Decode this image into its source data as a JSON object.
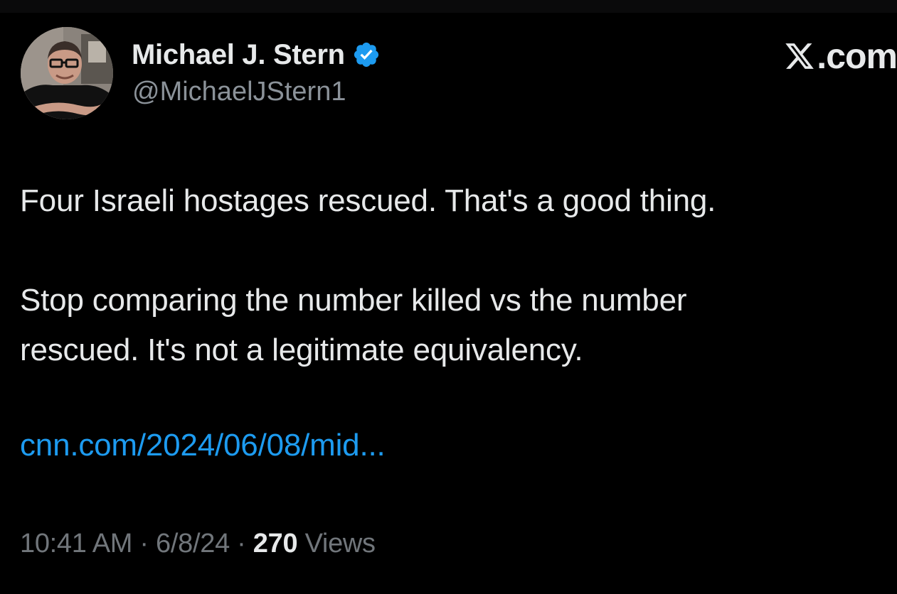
{
  "author": {
    "display_name": "Michael J. Stern",
    "handle": "@MichaelJStern1",
    "verified_icon": "verified-badge-icon",
    "verified_color": "#1d9bf0"
  },
  "brand": {
    "text": ".com",
    "icon": "x-logo-icon"
  },
  "tweet": {
    "paragraph_1": "Four Israeli hostages rescued.  That's a good thing.",
    "paragraph_2_line_1": "Stop comparing the number killed vs the number",
    "paragraph_2_line_2": "rescued.  It's not a legitimate equivalency.",
    "link_text": "cnn.com/2024/06/08/mid...",
    "link_color": "#1d9bf0"
  },
  "meta": {
    "time": "10:41 AM",
    "separator": "·",
    "date": "6/8/24",
    "views_count": "270",
    "views_label": "Views"
  },
  "colors": {
    "background": "#000000",
    "primary_text": "#e7e9ea",
    "secondary_text": "#71767b"
  }
}
